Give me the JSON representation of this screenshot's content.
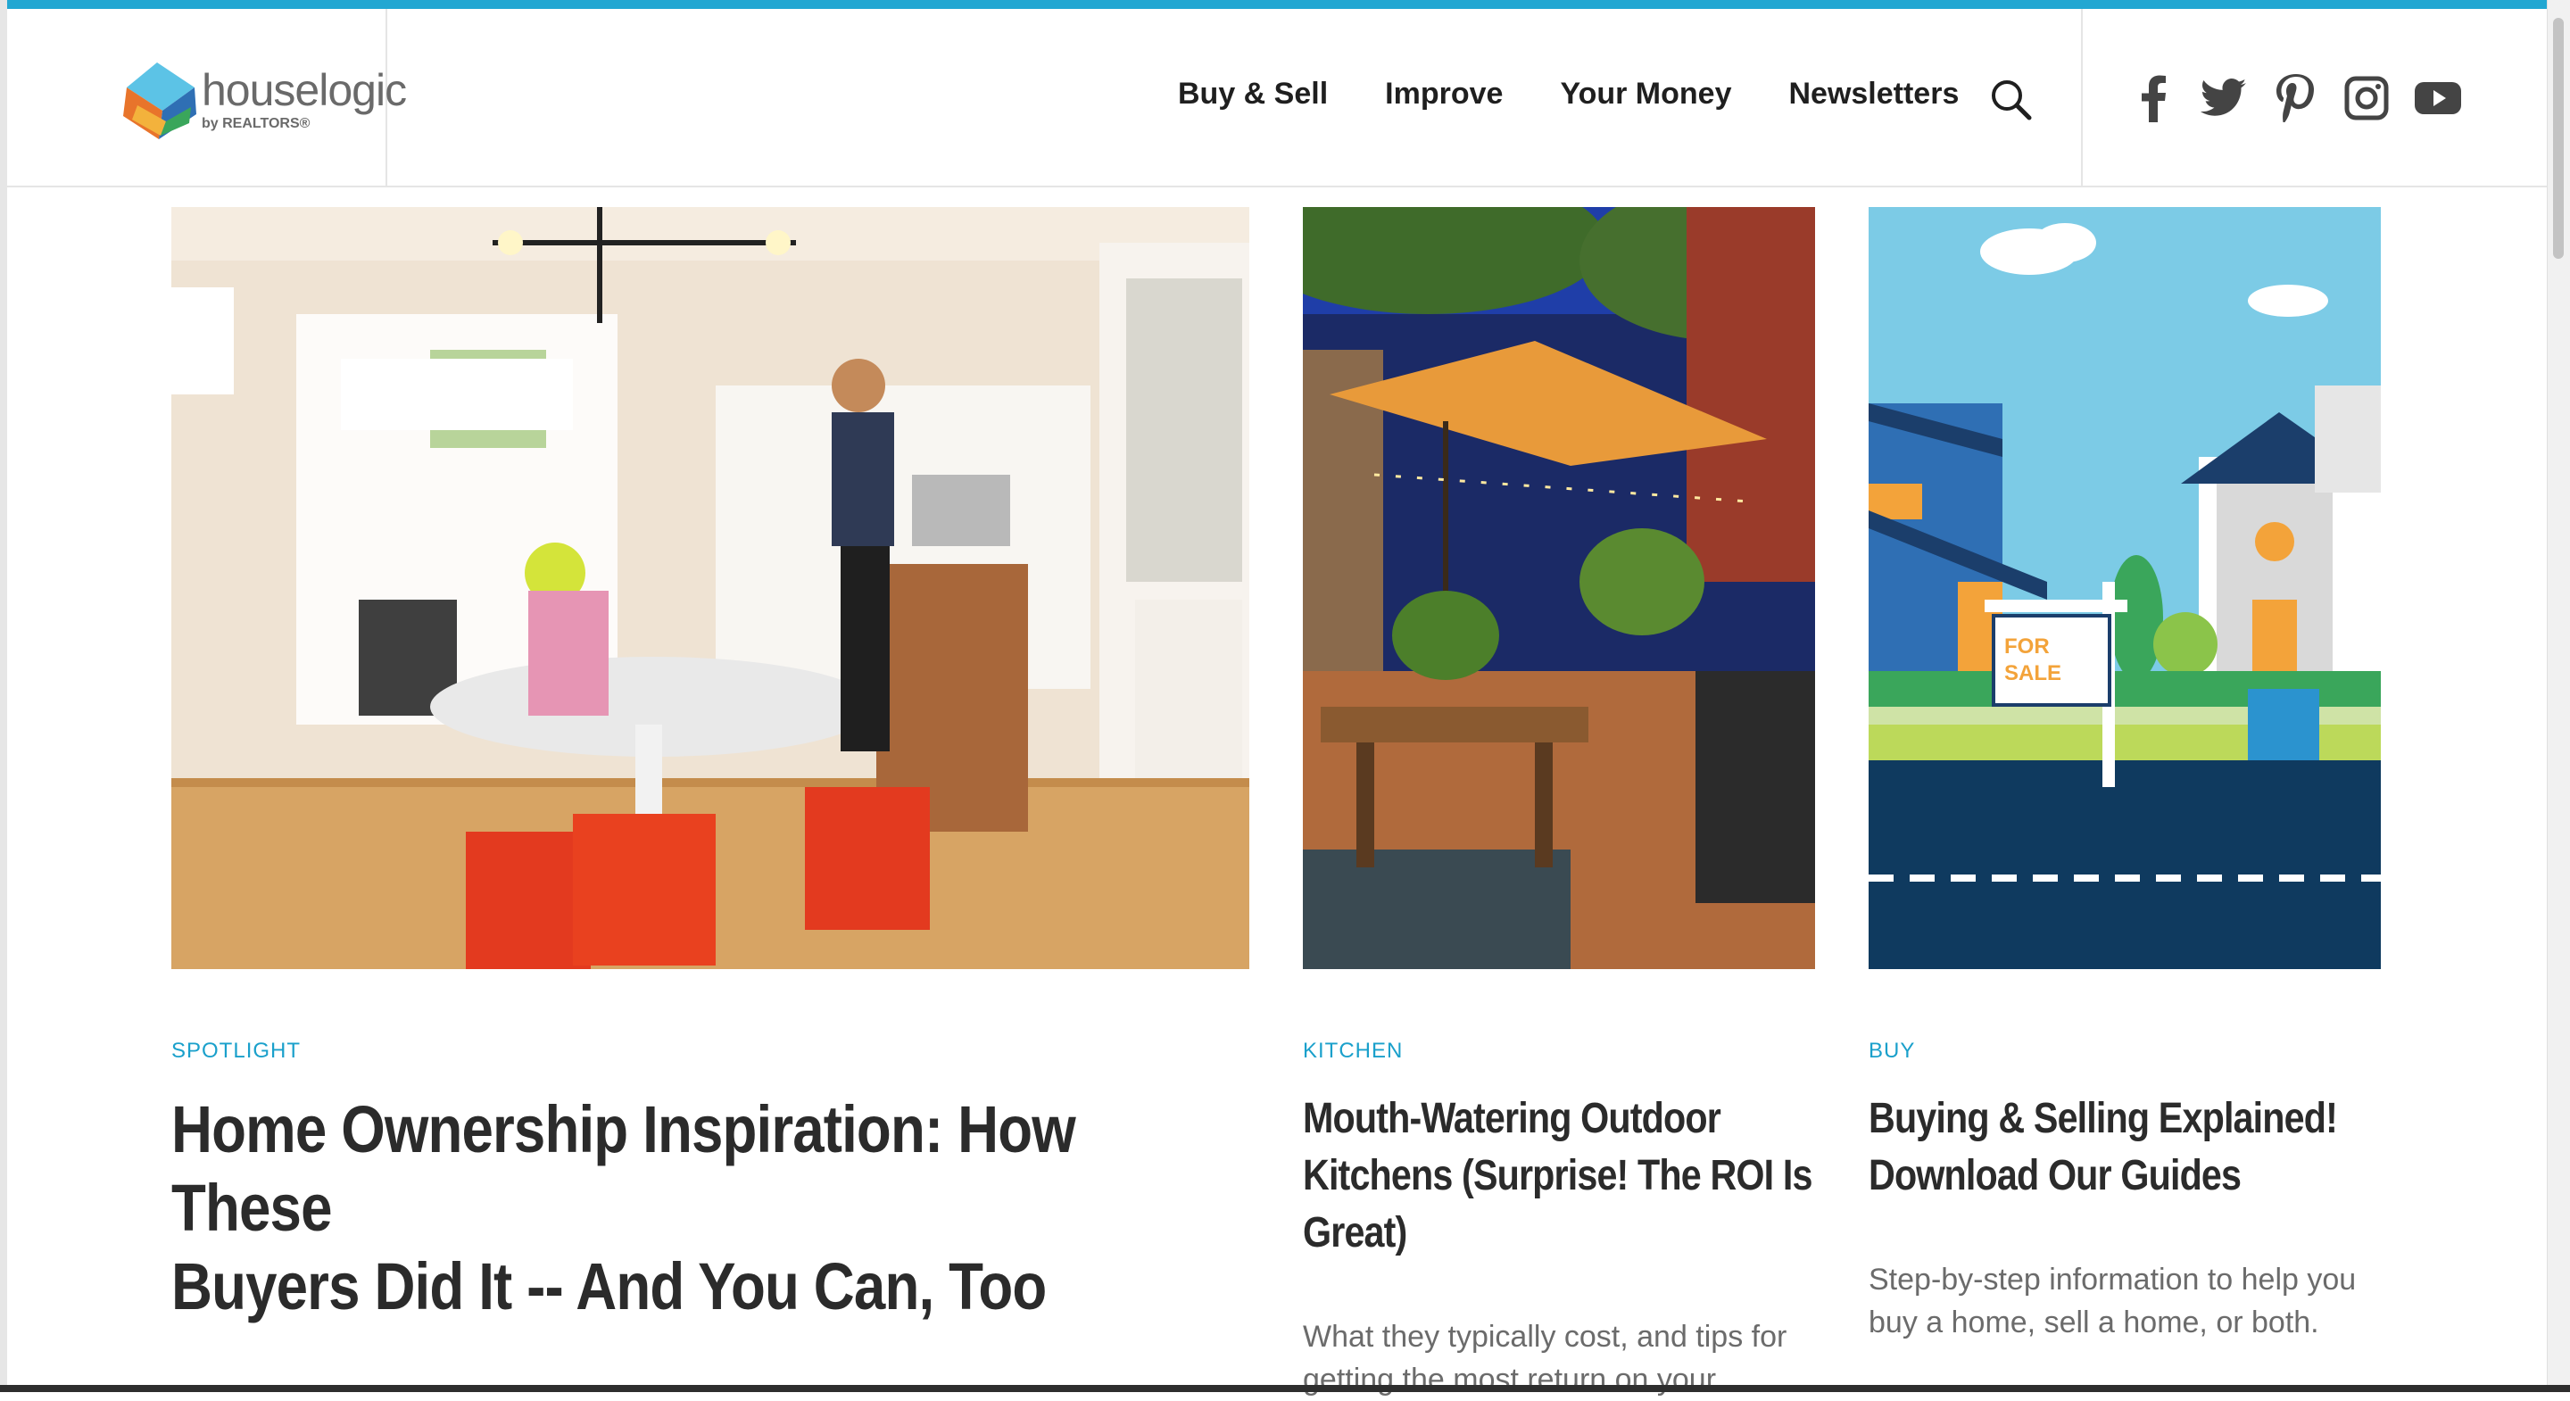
{
  "brand": {
    "name": "houselogic",
    "tagline": "by REALTORS®"
  },
  "nav": {
    "items": [
      {
        "label": "Buy & Sell"
      },
      {
        "label": "Improve"
      },
      {
        "label": "Your Money"
      },
      {
        "label": "Newsletters"
      }
    ],
    "search_icon": "search-icon"
  },
  "social": {
    "icons": [
      "facebook-icon",
      "twitter-icon",
      "pinterest-icon",
      "instagram-icon",
      "youtube-icon"
    ]
  },
  "cards": [
    {
      "category": "SPOTLIGHT",
      "title_line1": "Home Ownership Inspiration: How These",
      "title_line2": "Buyers Did It -- And You Can, Too",
      "image": "kitchen-couple-photo"
    },
    {
      "category": "KITCHEN",
      "title_line1": "Mouth-Watering Outdoor",
      "title_line2": "Kitchens (Surprise! The ROI Is",
      "title_line3": "Great)",
      "desc_line1": "What they typically cost, and tips for",
      "desc_line2": "getting the most return on your",
      "image": "outdoor-kitchen-photo"
    },
    {
      "category": "BUY",
      "title_line1": "Buying & Selling Explained!",
      "title_line2": "Download Our Guides",
      "desc_line1": "Step-by-step information to help you",
      "desc_line2": "buy a home, sell a home, or both.",
      "sign_line1": "FOR",
      "sign_line2": "SALE",
      "image": "for-sale-illustration"
    }
  ],
  "colors": {
    "accent": "#22a7d2",
    "category": "#1aa0cb",
    "headline": "#2b2b2b",
    "body": "#6b6b6b"
  }
}
